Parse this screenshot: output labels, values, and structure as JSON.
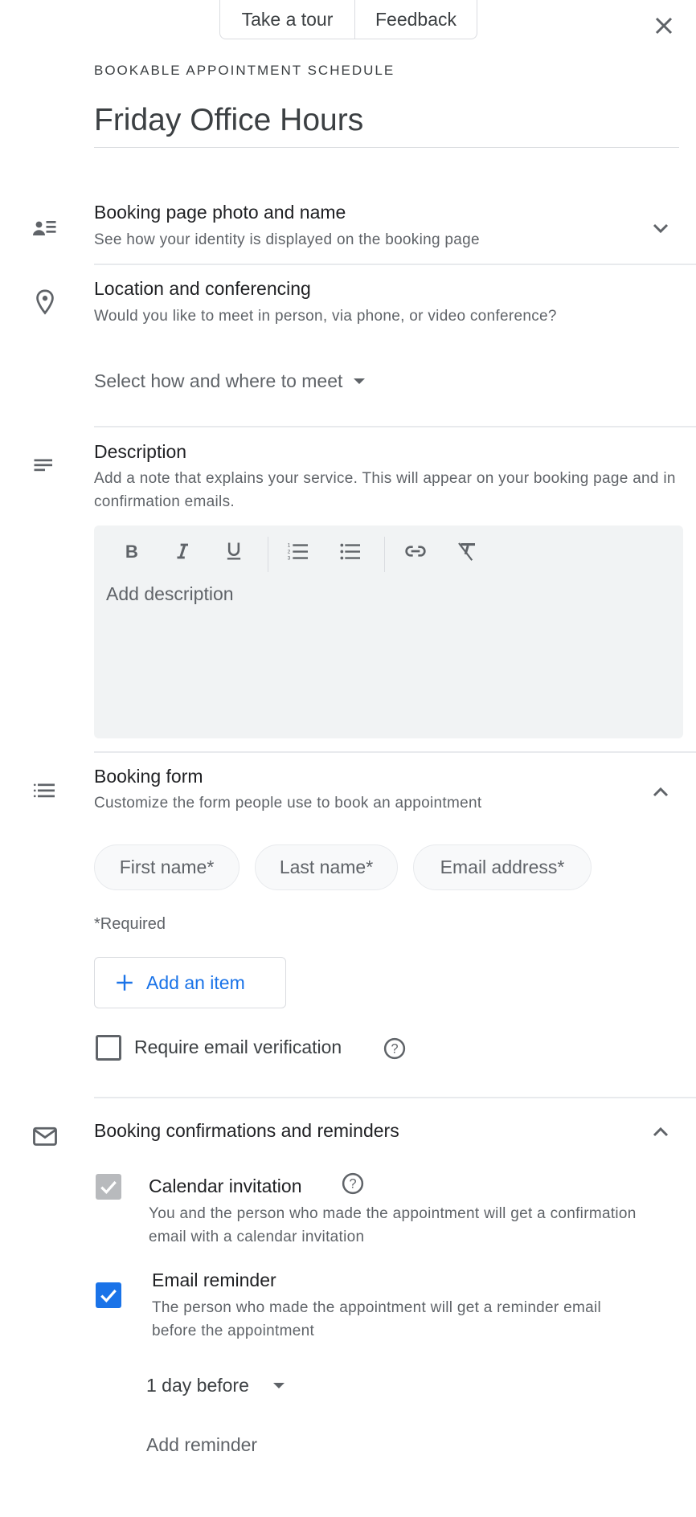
{
  "header": {
    "take_tour_label": "Take a tour",
    "feedback_label": "Feedback",
    "eyebrow": "BOOKABLE APPOINTMENT SCHEDULE",
    "title": "Friday Office Hours"
  },
  "sections": {
    "booking_page": {
      "title": "Booking page photo and name",
      "subtitle": "See how your identity is displayed on the booking page",
      "icon": "person-list-icon",
      "expanded": false
    },
    "location": {
      "title": "Location and conferencing",
      "subtitle": "Would you like to meet in person, via phone, or video conference?",
      "icon": "location-pin-icon",
      "select_label": "Select how and where to meet"
    },
    "description": {
      "title": "Description",
      "subtitle": "Add a note that explains your service. This will appear on your booking page and in confirmation emails.",
      "icon": "notes-icon",
      "placeholder": "Add description",
      "toolbar": [
        "bold",
        "italic",
        "underline",
        "numbered-list",
        "bulleted-list",
        "link",
        "clear-formatting"
      ]
    },
    "booking_form": {
      "title": "Booking form",
      "subtitle": "Customize the form people use to book an appointment",
      "icon": "list-icon",
      "expanded": true,
      "fields": [
        "First name*",
        "Last name*",
        "Email address*"
      ],
      "required_note": "*Required",
      "add_item_label": "Add an item",
      "email_verification_label": "Require email verification",
      "email_verification_checked": false
    },
    "confirmations": {
      "title": "Booking confirmations and reminders",
      "icon": "mail-icon",
      "expanded": true,
      "calendar_invitation": {
        "title": "Calendar invitation",
        "description": "You and the person who made the appointment will get a confirmation email with a calendar invitation",
        "checked": true,
        "disabled": true
      },
      "email_reminder": {
        "title": "Email reminder",
        "description": "The person who made the appointment will get a reminder email before the appointment",
        "checked": true
      },
      "reminder_timing": "1 day before",
      "add_reminder_label": "Add reminder"
    }
  },
  "colors": {
    "accent": "#1a73e8",
    "text_primary": "#202124",
    "text_secondary": "#5f6368",
    "divider": "#e8eaed",
    "editor_bg": "#f1f3f4"
  }
}
